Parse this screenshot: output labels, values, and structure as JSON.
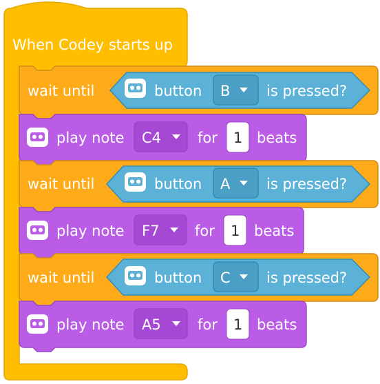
{
  "script": {
    "hat_label": "When Codey starts up",
    "blocks": [
      {
        "type": "wait",
        "label": "wait until",
        "sensor": "button",
        "value": "B",
        "suffix": "is pressed?",
        "icon": "codey-robot-icon"
      },
      {
        "type": "note",
        "label": "play note",
        "note": "C4",
        "for_label": "for",
        "beats_value": "1",
        "beats_label": "beats",
        "icon": "codey-robot-icon"
      },
      {
        "type": "wait",
        "label": "wait until",
        "sensor": "button",
        "value": "A",
        "suffix": "is pressed?",
        "icon": "codey-robot-icon"
      },
      {
        "type": "note",
        "label": "play note",
        "note": "F7",
        "for_label": "for",
        "beats_value": "1",
        "beats_label": "beats",
        "icon": "codey-robot-icon"
      },
      {
        "type": "wait",
        "label": "wait until",
        "sensor": "button",
        "value": "C",
        "suffix": "is pressed?",
        "icon": "codey-robot-icon"
      },
      {
        "type": "note",
        "label": "play note",
        "note": "A5",
        "for_label": "for",
        "beats_value": "1",
        "beats_label": "beats",
        "icon": "codey-robot-icon"
      }
    ]
  },
  "colors": {
    "events": "#FFBF00",
    "events_border": "#E6A800",
    "control": "#FFAB19",
    "control_border": "#CF8B17",
    "sensing": "#5CB1D6",
    "sensing_border": "#2E8EB8",
    "sound": "#BA5CE6",
    "sound_border": "#9A46C7",
    "sound_dark": "#A548D4"
  }
}
